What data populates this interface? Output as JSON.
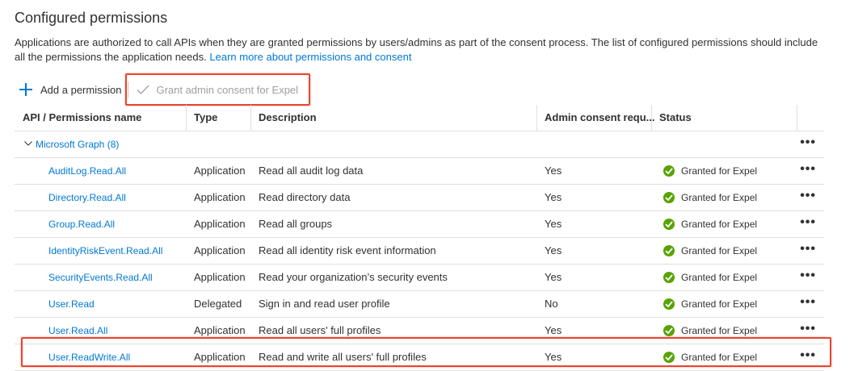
{
  "page": {
    "title": "Configured permissions",
    "description": "Applications are authorized to call APIs when they are granted permissions by users/admins as part of the consent process. The list of configured permissions should include all the permissions the application needs.",
    "learn_more": "Learn more about permissions and consent"
  },
  "toolbar": {
    "add_label": "Add a permission",
    "grant_label": "Grant admin consent for Expel"
  },
  "table": {
    "headers": [
      "API / Permissions name",
      "Type",
      "Description",
      "Admin consent requ...",
      "Status"
    ],
    "group": {
      "label": "Microsoft Graph (8)",
      "more": "•••"
    },
    "rows": [
      {
        "name": "AuditLog.Read.All",
        "type": "Application",
        "description": "Read all audit log data",
        "admin": "Yes",
        "status": "Granted for Expel",
        "more": "•••"
      },
      {
        "name": "Directory.Read.All",
        "type": "Application",
        "description": "Read directory data",
        "admin": "Yes",
        "status": "Granted for Expel",
        "more": "•••"
      },
      {
        "name": "Group.Read.All",
        "type": "Application",
        "description": "Read all groups",
        "admin": "Yes",
        "status": "Granted for Expel",
        "more": "•••"
      },
      {
        "name": "IdentityRiskEvent.Read.All",
        "type": "Application",
        "description": "Read all identity risk event information",
        "admin": "Yes",
        "status": "Granted for Expel",
        "more": "•••"
      },
      {
        "name": "SecurityEvents.Read.All",
        "type": "Application",
        "description": "Read your organization’s security events",
        "admin": "Yes",
        "status": "Granted for Expel",
        "more": "•••"
      },
      {
        "name": "User.Read",
        "type": "Delegated",
        "description": "Sign in and read user profile",
        "admin": "No",
        "status": "Granted for Expel",
        "more": "•••"
      },
      {
        "name": "User.Read.All",
        "type": "Application",
        "description": "Read all users' full profiles",
        "admin": "Yes",
        "status": "Granted for Expel",
        "more": "•••"
      },
      {
        "name": "User.ReadWrite.All",
        "type": "Application",
        "description": "Read and write all users' full profiles",
        "admin": "Yes",
        "status": "Granted for Expel",
        "more": "•••"
      }
    ]
  },
  "colors": {
    "link": "#0078d4",
    "ok": "#57a300",
    "highlight": "#e8452f"
  }
}
